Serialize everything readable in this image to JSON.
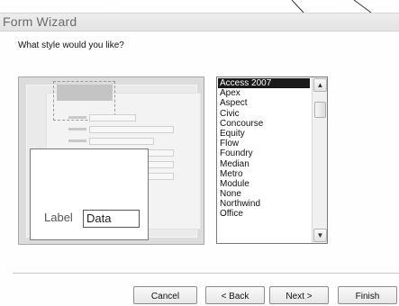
{
  "window": {
    "title": "Form Wizard"
  },
  "prompt": "What style would you like?",
  "preview": {
    "label_text": "Label",
    "data_text": "Data"
  },
  "styles": {
    "selected": "Access 2007",
    "items": [
      "Access 2007",
      "Apex",
      "Aspect",
      "Civic",
      "Concourse",
      "Equity",
      "Flow",
      "Foundry",
      "Median",
      "Metro",
      "Module",
      "None",
      "Northwind",
      "Office"
    ]
  },
  "buttons": {
    "cancel": "Cancel",
    "back": "< Back",
    "next": "Next >",
    "finish": "Finish"
  }
}
